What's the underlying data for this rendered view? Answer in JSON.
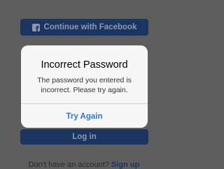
{
  "background": {
    "facebook_button_label": "Continue with Facebook",
    "login_button_label": "Log in",
    "signup_prompt": "Don't have an account?",
    "signup_link": "Sign up"
  },
  "alert": {
    "title": "Incorrect Password",
    "message": "The password you entered is incorrect. Please try again.",
    "action_label": "Try Again"
  },
  "colors": {
    "overlay": "#5e5e5e",
    "dimmed_button": "#1b3563",
    "alert_background": "#f6f6f6",
    "action_blue": "#2f78d3"
  },
  "icons": {
    "facebook": "facebook-icon"
  }
}
